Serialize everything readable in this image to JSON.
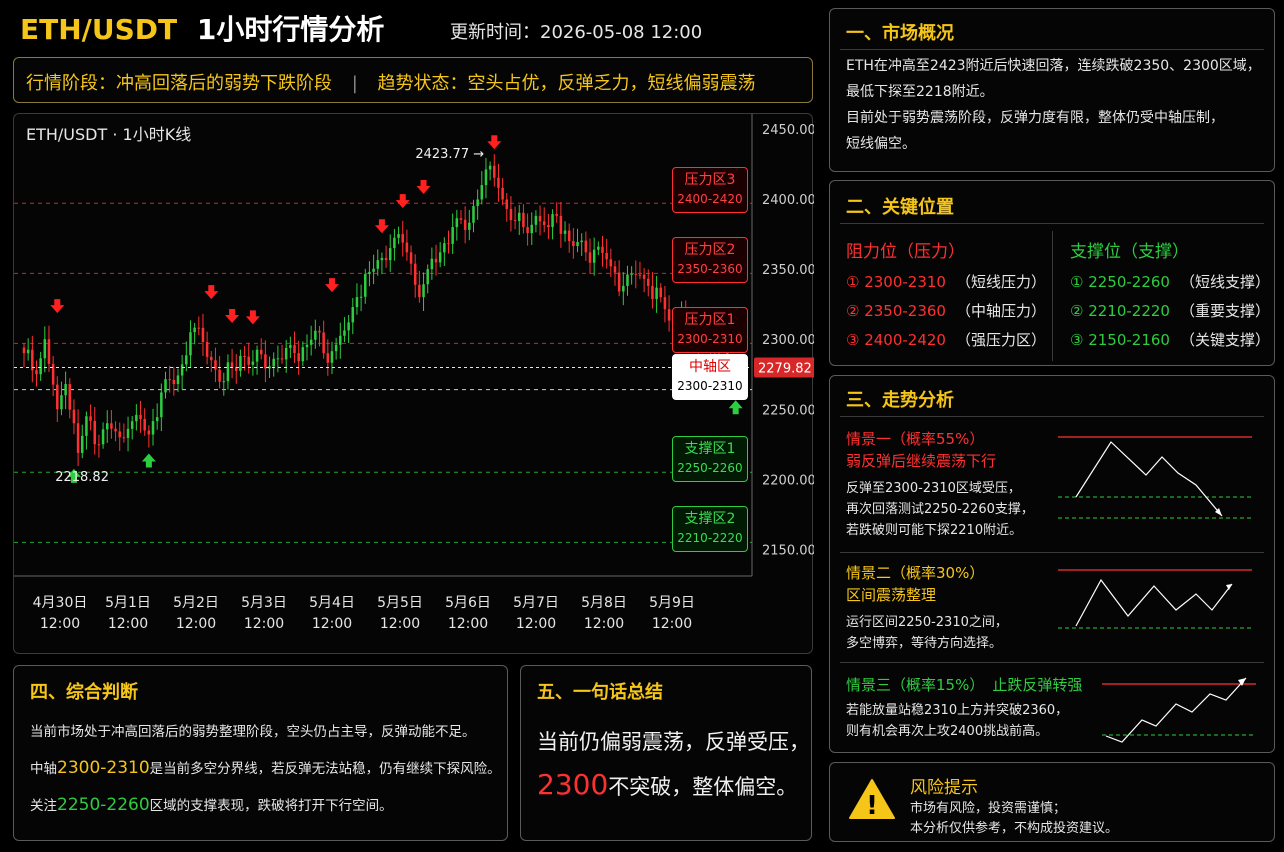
{
  "header": {
    "symbol": "ETH/USDT",
    "title": "1小时行情分析",
    "update_label": "更新时间：",
    "update_time": "2026-05-08 12:00"
  },
  "stage_bar": {
    "phase_label": "行情阶段：",
    "phase_value": "冲高回落后的弱势下跌阶段",
    "separator": "|",
    "trend_label": "趋势状态：",
    "trend_value": "空头占优，反弹乏力，短线偏弱震荡"
  },
  "chart_data": {
    "type": "candlestick",
    "title": "ETH/USDT · 1小时K线",
    "ylim": [
      2131,
      2455
    ],
    "yticks": [
      2450,
      2400,
      2350,
      2300,
      2250,
      2200,
      2150
    ],
    "ytick_labels": [
      "2450.00",
      "2400.00",
      "2350.00",
      "2300.00",
      "2250.00",
      "2200.00",
      "2150.00"
    ],
    "x_dates": [
      "4月30日",
      "5月1日",
      "5月2日",
      "5月3日",
      "5月4日",
      "5月5日",
      "5月6日",
      "5月7日",
      "5月8日",
      "5月9日"
    ],
    "x_times": [
      "12:00",
      "12:00",
      "12:00",
      "12:00",
      "12:00",
      "12:00",
      "12:00",
      "12:00",
      "12:00",
      "12:00"
    ],
    "close_path": [
      [
        0,
        2290
      ],
      [
        3,
        2275
      ],
      [
        5,
        2300
      ],
      [
        8,
        2250
      ],
      [
        10,
        2268
      ],
      [
        12,
        2240
      ],
      [
        13,
        2218.82
      ],
      [
        15,
        2245
      ],
      [
        18,
        2225
      ],
      [
        20,
        2240
      ],
      [
        23,
        2230
      ],
      [
        25,
        2236
      ],
      [
        27,
        2246
      ],
      [
        30,
        2232
      ],
      [
        33,
        2262
      ],
      [
        36,
        2268
      ],
      [
        38,
        2282
      ],
      [
        40,
        2305
      ],
      [
        43,
        2298
      ],
      [
        45,
        2285
      ],
      [
        48,
        2270
      ],
      [
        52,
        2288
      ],
      [
        55,
        2284
      ],
      [
        60,
        2286
      ],
      [
        65,
        2290
      ],
      [
        68,
        2296
      ],
      [
        70,
        2306
      ],
      [
        72,
        2290
      ],
      [
        75,
        2296
      ],
      [
        78,
        2312
      ],
      [
        80,
        2330
      ],
      [
        83,
        2348
      ],
      [
        86,
        2358
      ],
      [
        88,
        2365
      ],
      [
        90,
        2375
      ],
      [
        92,
        2362
      ],
      [
        95,
        2330
      ],
      [
        97,
        2350
      ],
      [
        100,
        2362
      ],
      [
        103,
        2380
      ],
      [
        106,
        2378
      ],
      [
        108,
        2395
      ],
      [
        110,
        2410
      ],
      [
        112,
        2423.77
      ],
      [
        114,
        2408
      ],
      [
        117,
        2385
      ],
      [
        120,
        2380
      ],
      [
        123,
        2388
      ],
      [
        126,
        2380
      ],
      [
        128,
        2388
      ],
      [
        131,
        2370
      ],
      [
        135,
        2362
      ],
      [
        138,
        2366
      ],
      [
        141,
        2352
      ],
      [
        144,
        2338
      ],
      [
        147,
        2346
      ],
      [
        150,
        2338
      ],
      [
        153,
        2330
      ],
      [
        156,
        2306
      ],
      [
        158,
        2318
      ],
      [
        161,
        2296
      ],
      [
        164,
        2302
      ],
      [
        167,
        2298
      ],
      [
        170,
        2276
      ],
      [
        172,
        2272
      ],
      [
        173,
        2279.82
      ]
    ],
    "n_candles": 174,
    "high_marker": {
      "index": 112,
      "value": 2423.77,
      "label": "2423.77 →"
    },
    "low_marker": {
      "index": 13,
      "value": 2218.82,
      "label": "2218.82"
    },
    "last_price": 2279.82,
    "last_price_label": "2279.82",
    "sell_signals": [
      {
        "index": 8,
        "value": 2320
      },
      {
        "index": 45,
        "value": 2330
      },
      {
        "index": 50,
        "value": 2313
      },
      {
        "index": 55,
        "value": 2312
      },
      {
        "index": 74,
        "value": 2335
      },
      {
        "index": 86,
        "value": 2377
      },
      {
        "index": 91,
        "value": 2395
      },
      {
        "index": 96,
        "value": 2405
      },
      {
        "index": 113,
        "value": 2437
      }
    ],
    "buy_signals": [
      {
        "index": 12,
        "value": 2206
      },
      {
        "index": 30,
        "value": 2217
      },
      {
        "index": 160,
        "value": 2286
      },
      {
        "index": 171,
        "value": 2255
      }
    ],
    "zones": [
      {
        "kind": "resist",
        "name": "压力区3",
        "range": "2400-2420",
        "line": 2397
      },
      {
        "kind": "resist",
        "name": "压力区2",
        "range": "2350-2360",
        "line": 2347
      },
      {
        "kind": "resist",
        "name": "压力区1",
        "range": "2300-2310",
        "line": 2297
      },
      {
        "kind": "pivot",
        "name": "中轴区",
        "range": "2300-2310",
        "line": 2264
      },
      {
        "kind": "support",
        "name": "支撑区1",
        "range": "2250-2260",
        "line": 2205
      },
      {
        "kind": "support",
        "name": "支撑区2",
        "range": "2210-2220",
        "line": 2155
      }
    ]
  },
  "overview": {
    "title": "一、市场概况",
    "lines": [
      "ETH在冲高至2423附近后快速回落，连续跌破2350、2300区域，",
      "最低下探至2218附近。",
      "目前处于弱势震荡阶段，反弹力度有限，整体仍受中轴压制，",
      "短线偏空。"
    ]
  },
  "key_levels": {
    "title": "二、关键位置",
    "resist_title": "阻力位（压力）",
    "support_title": "支撑位（支撑）",
    "resist": [
      {
        "range": "① 2300-2310",
        "note": "（短线压力）"
      },
      {
        "range": "② 2350-2360",
        "note": "（中轴压力）"
      },
      {
        "range": "③ 2400-2420",
        "note": "（强压力区）"
      }
    ],
    "support": [
      {
        "range": "① 2250-2260",
        "note": "（短线支撑）"
      },
      {
        "range": "② 2210-2220",
        "note": "（重要支撑）"
      },
      {
        "range": "③ 2150-2160",
        "note": "（关键支撑）"
      }
    ]
  },
  "trend": {
    "title": "三、走势分析",
    "scenarios": [
      {
        "title": "情景一（概率55%）",
        "subtitle": "弱反弹后继续震荡下行",
        "body": [
          "反弹至2300-2310区域受压，",
          "再次回落测试2250-2260支撑，",
          "若跌破则可能下探2210附近。"
        ],
        "color": "#ff3030"
      },
      {
        "title": "情景二（概率30%）",
        "subtitle": "区间震荡整理",
        "body": [
          "运行区间2250-2310之间，",
          "多空博弈，等待方向选择。"
        ],
        "color": "#f5c518"
      },
      {
        "title": "情景三（概率15%）",
        "subtitle": "止跌反弹转强",
        "body": [
          "若能放量站稳2310上方并突破2360，",
          "则有机会再次上攻2400挑战前高。"
        ],
        "color": "#2ecc40"
      }
    ]
  },
  "judgement": {
    "title": "四、综合判断",
    "line1": "当前市场处于冲高回落后的弱势整理阶段，空头仍占主导，反弹动能不足。",
    "line2_a": "中轴",
    "line2_hl": "2300-2310",
    "line2_b": "是当前多空分界线，若反弹无法站稳，仍有继续下探风险。",
    "line3_a": "关注",
    "line3_hl": "2250-2260",
    "line3_b": "区域的支撑表现，跌破将打开下行空间。"
  },
  "summary": {
    "title": "五、一句话总结",
    "line1": "当前仍偏弱震荡，反弹受压，",
    "line2_hl": "2300",
    "line2_b": "不突破，整体偏空。"
  },
  "risk": {
    "title": "风险提示",
    "line1": "市场有风险，投资需谨慎；",
    "line2": "本分析仅供参考，不构成投资建议。",
    "icon": "warning-icon",
    "icon_glyph": "!"
  },
  "colors": {
    "up": "#2ecc40",
    "down": "#ff3030",
    "gold": "#f5c518",
    "resist": "#ff3030",
    "support": "#2ecc40"
  }
}
